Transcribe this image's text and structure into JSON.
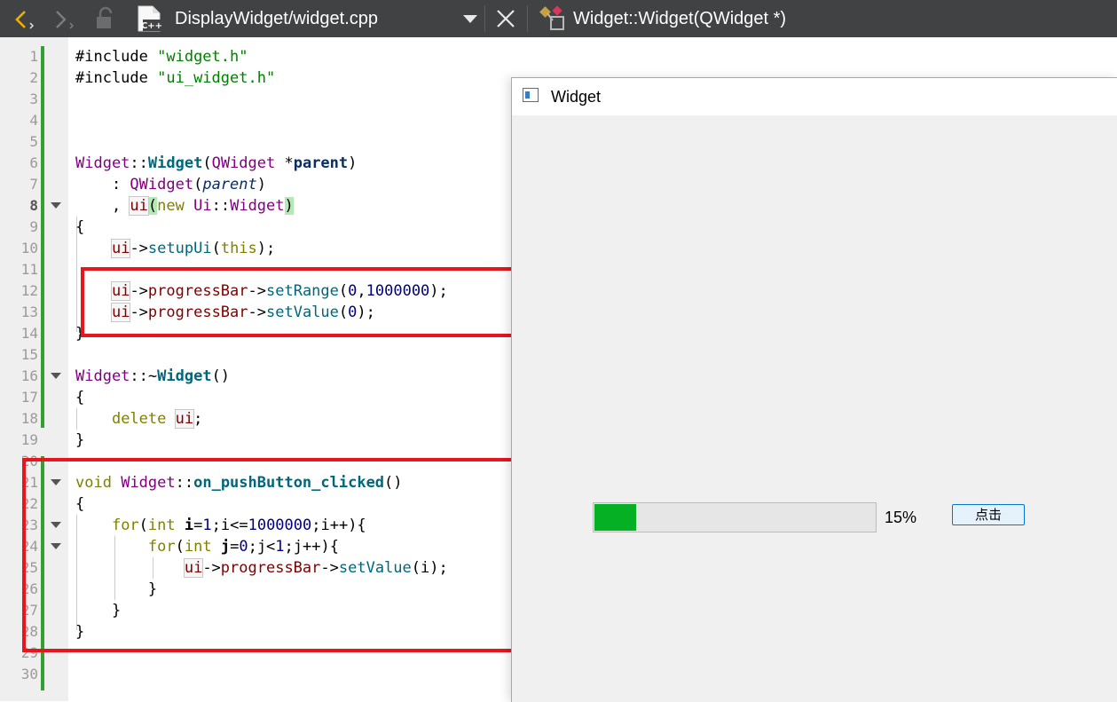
{
  "toolbar": {
    "file_name": "DisplayWidget/widget.cpp",
    "function_name": "Widget::Widget(QWidget *)",
    "back_icon": "chevron-left-icon",
    "forward_icon": "chevron-right-icon",
    "lock_icon": "lock-icon",
    "file_icon": "cpp-file-icon",
    "dropdown_icon": "caret-down-icon",
    "close_icon": "close-icon",
    "symbol_icon": "class-symbol-icon"
  },
  "editor": {
    "line_numbers": [
      "1",
      "2",
      "3",
      "4",
      "5",
      "6",
      "7",
      "8",
      "9",
      "10",
      "11",
      "12",
      "13",
      "14",
      "15",
      "16",
      "17",
      "18",
      "19",
      "20",
      "21",
      "22",
      "23",
      "24",
      "25",
      "26",
      "27",
      "28",
      "29",
      "30"
    ],
    "current_line": 8,
    "fold_lines": [
      8,
      16,
      21,
      23,
      24
    ],
    "lines": {
      "l1_a": "#include ",
      "l1_b": "\"widget.h\"",
      "l2_a": "#include ",
      "l2_b": "\"ui_widget.h\"",
      "l6_a": "Widget",
      "l6_b": "::",
      "l6_c": "Widget",
      "l6_d": "(",
      "l6_e": "QWidget",
      "l6_f": " *",
      "l6_g": "parent",
      "l6_h": ")",
      "l7_a": "    : ",
      "l7_b": "QWidget",
      "l7_c": "(",
      "l7_d": "parent",
      "l7_e": ")",
      "l8_a": "    , ",
      "l8_b": "ui",
      "l8_c": "(",
      "l8_d": "new",
      "l8_e": " ",
      "l8_f": "Ui",
      "l8_g": "::",
      "l8_h": "Widget",
      "l8_i": ")",
      "l9": "{",
      "l10_a": "    ",
      "l10_b": "ui",
      "l10_c": "->",
      "l10_d": "setupUi",
      "l10_e": "(",
      "l10_f": "this",
      "l10_g": ");",
      "l12_a": "    ",
      "l12_b": "ui",
      "l12_c": "->",
      "l12_d": "progressBar",
      "l12_e": "->",
      "l12_f": "setRange",
      "l12_g": "(",
      "l12_h": "0",
      "l12_i": ",",
      "l12_j": "1000000",
      "l12_k": ");",
      "l13_a": "    ",
      "l13_b": "ui",
      "l13_c": "->",
      "l13_d": "progressBar",
      "l13_e": "->",
      "l13_f": "setValue",
      "l13_g": "(",
      "l13_h": "0",
      "l13_i": ");",
      "l14": "}",
      "l16_a": "Widget",
      "l16_b": "::~",
      "l16_c": "Widget",
      "l16_d": "()",
      "l17": "{",
      "l18_a": "    ",
      "l18_b": "delete",
      "l18_c": " ",
      "l18_d": "ui",
      "l18_e": ";",
      "l19": "}",
      "l21_a": "void",
      "l21_b": " ",
      "l21_c": "Widget",
      "l21_d": "::",
      "l21_e": "on_pushButton_clicked",
      "l21_f": "()",
      "l22": "{",
      "l23_a": "    ",
      "l23_b": "for",
      "l23_c": "(",
      "l23_d": "int",
      "l23_e": " ",
      "l23_f": "i",
      "l23_g": "=",
      "l23_h": "1",
      "l23_i": ";i<=",
      "l23_j": "1000000",
      "l23_k": ";i++){",
      "l24_a": "        ",
      "l24_b": "for",
      "l24_c": "(",
      "l24_d": "int",
      "l24_e": " ",
      "l24_f": "j",
      "l24_g": "=",
      "l24_h": "0",
      "l24_i": ";j<",
      "l24_j": "1",
      "l24_k": ";j++){",
      "l25_a": "            ",
      "l25_b": "ui",
      "l25_c": "->",
      "l25_d": "progressBar",
      "l25_e": "->",
      "l25_f": "setValue",
      "l25_g": "(i);",
      "l26": "        }",
      "l27": "    }",
      "l28": "}"
    }
  },
  "widget_window": {
    "title": "Widget",
    "window_icon": "window-icon",
    "progress_percent": 15,
    "progress_text": "15%",
    "button_label": "点击"
  },
  "colors": {
    "toolbar_bg": "#404244",
    "annotation_red": "#e8141e",
    "progress_green": "#06b025",
    "change_marker_green": "#33a033"
  }
}
